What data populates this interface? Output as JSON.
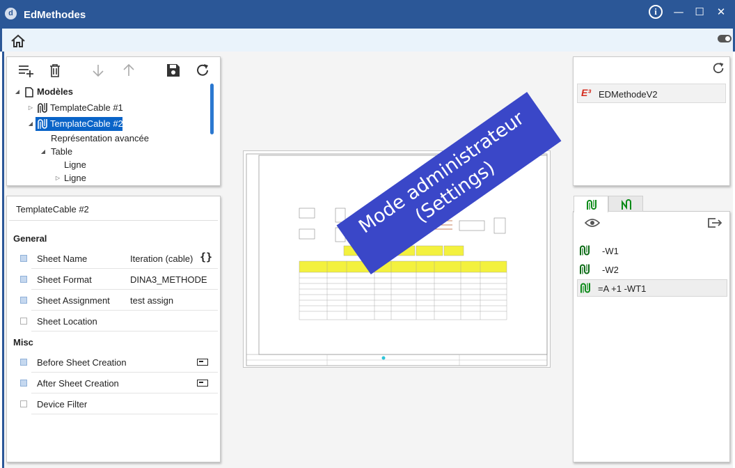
{
  "window": {
    "title": "EdMethodes",
    "logo_letter": "d",
    "info_label": "i",
    "minimize": "—",
    "maximize": "☐",
    "close": "✕"
  },
  "tree": {
    "root": "Modèles",
    "items": [
      {
        "label": "TemplateCable #1"
      },
      {
        "label": "TemplateCable #2"
      },
      {
        "label": "Représentation avancée"
      },
      {
        "label": "Table"
      },
      {
        "label": "Ligne"
      },
      {
        "label": "Ligne"
      }
    ]
  },
  "properties": {
    "title": "TemplateCable #2",
    "groups": {
      "general": "General",
      "misc": "Misc"
    },
    "rows": [
      {
        "name": "Sheet Name",
        "value": "Iteration (cable)"
      },
      {
        "name": "Sheet Format",
        "value": "DINA3_METHODE"
      },
      {
        "name": "Sheet Assignment",
        "value": "test assign"
      },
      {
        "name": "Sheet Location",
        "value": ""
      },
      {
        "name": "Before Sheet Creation",
        "value": ""
      },
      {
        "name": "After Sheet Creation",
        "value": ""
      },
      {
        "name": "Device Filter",
        "value": ""
      }
    ],
    "brace": "{}"
  },
  "banner": {
    "line1": "Mode administrateur",
    "line2": "(Settings)"
  },
  "models": {
    "logo": "E³",
    "items": [
      "EDMethodeV2"
    ]
  },
  "cables": {
    "items": [
      "-W1",
      "-W2",
      "=A +1 -WT1"
    ]
  }
}
